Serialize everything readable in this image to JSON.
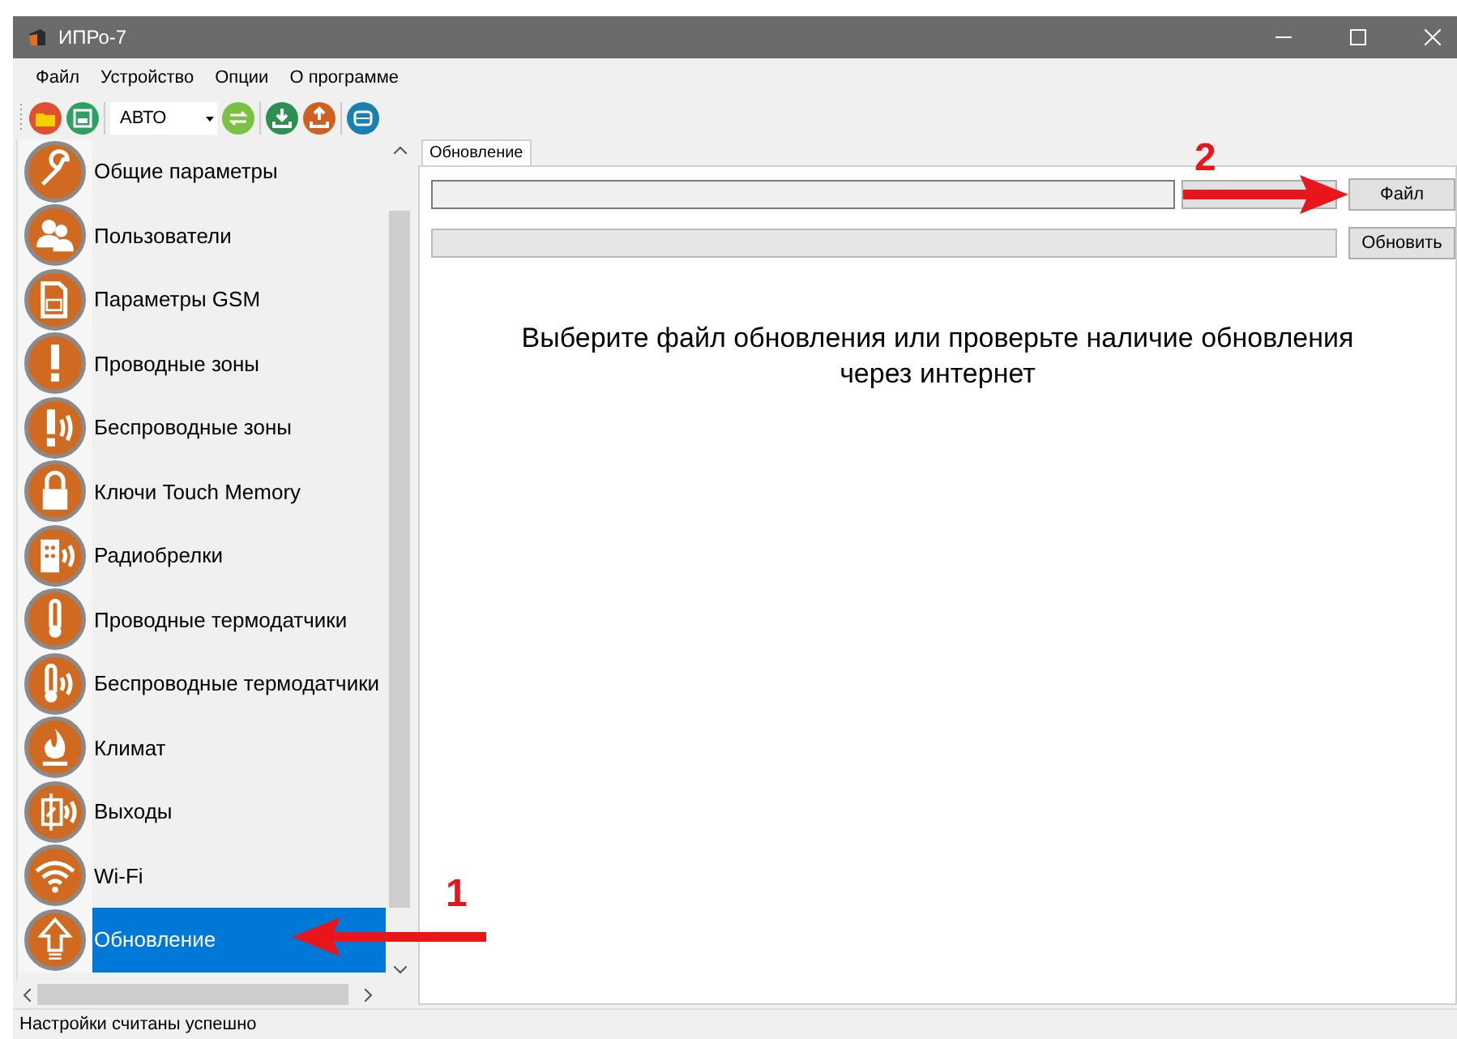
{
  "window": {
    "title": "ИПРо-7"
  },
  "menu": [
    "Файл",
    "Устройство",
    "Опции",
    "О программе"
  ],
  "toolbar": {
    "mode_select": {
      "value": "АВТО"
    }
  },
  "sidebar": {
    "items": [
      {
        "label": "Общие параметры",
        "selected": false
      },
      {
        "label": "Пользователи",
        "selected": false
      },
      {
        "label": "Параметры GSM",
        "selected": false
      },
      {
        "label": "Проводные зоны",
        "selected": false
      },
      {
        "label": "Беспроводные зоны",
        "selected": false
      },
      {
        "label": "Ключи Touch Memory",
        "selected": false
      },
      {
        "label": "Радиобрелки",
        "selected": false
      },
      {
        "label": "Проводные термодатчики",
        "selected": false
      },
      {
        "label": "Беспроводные термодатчики",
        "selected": false
      },
      {
        "label": "Климат",
        "selected": false
      },
      {
        "label": "Выходы",
        "selected": false
      },
      {
        "label": "Wi-Fi",
        "selected": false
      },
      {
        "label": "Обновление",
        "selected": true
      }
    ]
  },
  "tabs": [
    {
      "label": "Обновление",
      "selected": true
    }
  ],
  "update": {
    "progress": {
      "level": 0
    },
    "file_button": "Файл",
    "update_button": "Обновить",
    "message": "Выберите файл обновления или проверьте наличие обновления через интернет"
  },
  "annotations": [
    {
      "label": "1"
    },
    {
      "label": "2"
    }
  ],
  "status_bar": "Настройки считаны успешно"
}
